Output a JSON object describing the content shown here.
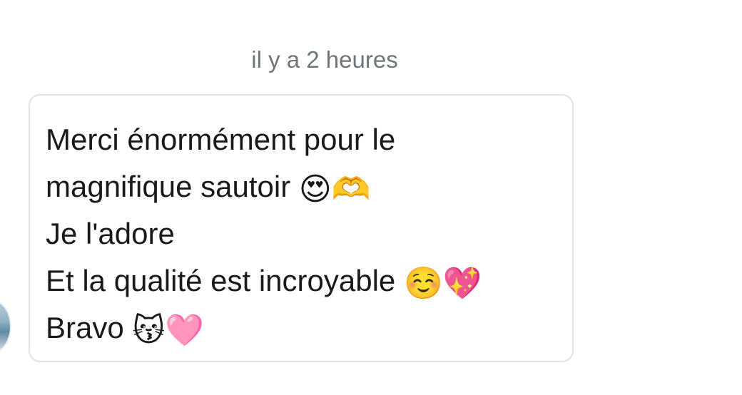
{
  "conversation": {
    "timestamp": "il y a 2 heures",
    "message": {
      "lines": [
        {
          "text": "Merci énormément pour le",
          "emojis": []
        },
        {
          "text": "magnifique sautoir",
          "emojis": [
            {
              "glyph": "😍",
              "name": "heart-eyes-emoji-icon"
            },
            {
              "glyph": "🫶",
              "name": "heart-hands-emoji-icon"
            }
          ]
        },
        {
          "text": "Je l'adore",
          "emojis": []
        },
        {
          "text": "Et la qualité est incroyable",
          "emojis": [
            {
              "glyph": "☺️",
              "name": "smiling-face-emoji-icon"
            },
            {
              "glyph": "💖",
              "name": "sparkling-heart-emoji-icon"
            }
          ]
        },
        {
          "text": "Bravo",
          "emojis": [
            {
              "glyph": "😽",
              "name": "kissing-cat-emoji-icon"
            },
            {
              "glyph": "🩷",
              "name": "pink-heart-emoji-icon"
            }
          ]
        }
      ]
    }
  }
}
